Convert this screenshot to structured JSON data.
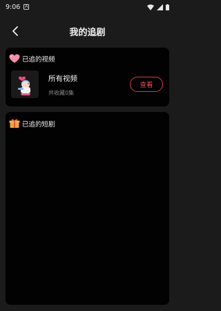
{
  "status_bar": {
    "time": "9:06",
    "notification_glyph": "A",
    "icons": [
      "wifi-icon",
      "signal-icon",
      "battery-icon"
    ]
  },
  "header": {
    "title": "我的追剧",
    "back_icon": "chevron-left-icon"
  },
  "followed_videos": {
    "heading": "已追的视频",
    "icon": "heart-icon",
    "item": {
      "title": "所有视频",
      "subtitle": "共收藏0集",
      "thumbnail_icon": "cartoon-character-icon",
      "button_label": "查看"
    }
  },
  "followed_shorts": {
    "heading": "已追的短剧",
    "icon": "gift-icon"
  },
  "colors": {
    "background": "#1b1b1b",
    "card": "#020202",
    "accent": "#e0373f"
  }
}
